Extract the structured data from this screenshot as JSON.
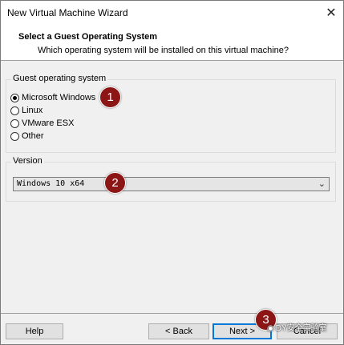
{
  "window": {
    "title": "New Virtual Machine Wizard"
  },
  "header": {
    "title": "Select a Guest Operating System",
    "subtitle": "Which operating system will be installed on this virtual machine?"
  },
  "os_group": {
    "label": "Guest operating system",
    "options": [
      "Microsoft Windows",
      "Linux",
      "VMware ESX",
      "Other"
    ],
    "selected": "Microsoft Windows"
  },
  "version_group": {
    "label": "Version",
    "selected_value": "Windows 10 x64"
  },
  "buttons": {
    "help": "Help",
    "back": "< Back",
    "next": "Next >",
    "cancel": "Cancel"
  },
  "annotations": {
    "step1": "1",
    "step2": "2",
    "step3": "3"
  },
  "watermark": "DY安全实验室",
  "colors": {
    "badge": "#8c1515",
    "focus_border": "#0078d7"
  }
}
